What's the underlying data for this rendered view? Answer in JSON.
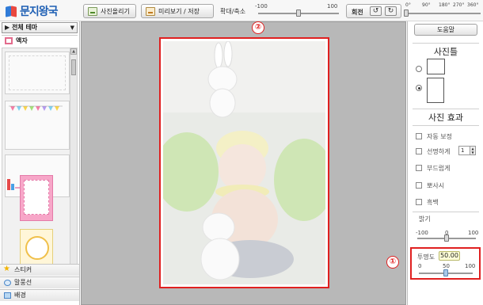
{
  "app": {
    "logo_text": "문지왕국"
  },
  "toolbar": {
    "upload_label": "사진올리기",
    "preview_save_label": "미리보기 / 저장",
    "zoom_label": "확대/축소",
    "zoom_min": "-100",
    "zoom_max": "100",
    "zoom_value": 0,
    "rotate_label": "회전",
    "rotate_left_icon": "rotate-ccw-icon",
    "rotate_right_icon": "rotate-cw-icon",
    "angle_ticks": [
      "0°",
      "90°",
      "180°",
      "270°",
      "360°"
    ],
    "angle_value": 0
  },
  "left_panel": {
    "theme_select": "▶ 전체 테마",
    "frame_category": "액자",
    "bottom_categories": [
      "스티커",
      "말풍선",
      "배경"
    ],
    "scroll_up": "▲",
    "scroll_down": "▼"
  },
  "canvas": {
    "marker_photo": "②",
    "marker_opacity": "①"
  },
  "right_panel": {
    "help_label": "도움말",
    "photo_frame_title": "사진틀",
    "photo_effect_title": "사진 효과",
    "effects": [
      {
        "label": "자동 보정"
      },
      {
        "label": "선명하게"
      },
      {
        "label": "부드럽게"
      },
      {
        "label": "뽀사시"
      },
      {
        "label": "흑백"
      }
    ],
    "sharpness_value": "1",
    "brightness_label": "밝기",
    "brightness_min": "-100",
    "brightness_mid": "0",
    "brightness_max": "100",
    "brightness_value": 0,
    "opacity_label": "투명도",
    "opacity_tooltip": "50.00",
    "opacity_min": "0",
    "opacity_mid": "50",
    "opacity_max": "100",
    "opacity_value": 50
  },
  "colors": {
    "highlight": "#e02020",
    "canvas_bg": "#b8b8b8",
    "logo_blue": "#1e5fb4"
  }
}
